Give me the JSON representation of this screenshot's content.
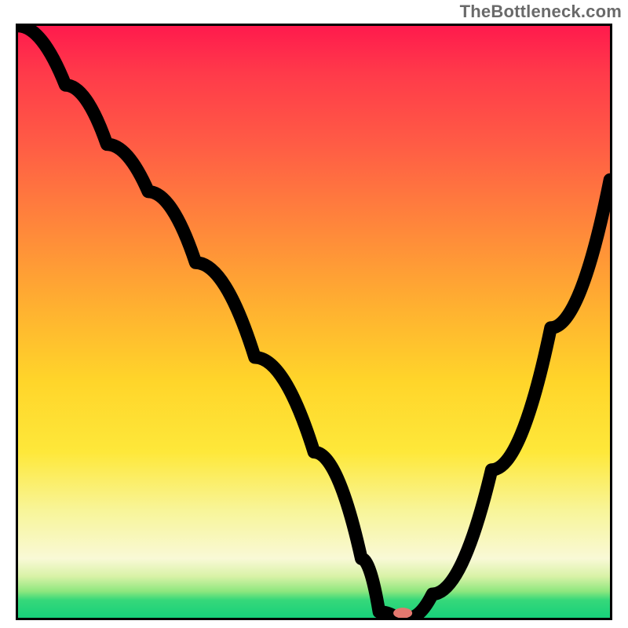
{
  "watermark": "TheBottleneck.com",
  "chart_data": {
    "type": "line",
    "title": "",
    "xlabel": "",
    "ylabel": "",
    "xlim": [
      0,
      100
    ],
    "ylim": [
      0,
      100
    ],
    "series": [
      {
        "name": "curve",
        "x": [
          0,
          8,
          15,
          22,
          30,
          40,
          50,
          58,
          61,
          64,
          66,
          70,
          80,
          90,
          100
        ],
        "y": [
          100,
          90,
          80,
          72,
          60,
          44,
          28,
          10,
          1,
          0,
          0,
          4,
          25,
          49,
          74
        ]
      }
    ],
    "marker": {
      "x": 65,
      "y": 0,
      "rx": 1.6,
      "ry": 0.9,
      "color": "#e4786f"
    },
    "gradient_stops": [
      {
        "pct": 0,
        "color": "#ff1a4d"
      },
      {
        "pct": 8,
        "color": "#ff3a4a"
      },
      {
        "pct": 20,
        "color": "#ff5c45"
      },
      {
        "pct": 35,
        "color": "#ff8a3a"
      },
      {
        "pct": 48,
        "color": "#ffb230"
      },
      {
        "pct": 60,
        "color": "#ffd52a"
      },
      {
        "pct": 72,
        "color": "#fee83a"
      },
      {
        "pct": 82,
        "color": "#f8f59a"
      },
      {
        "pct": 90,
        "color": "#f9f9d6"
      },
      {
        "pct": 93,
        "color": "#d9f2a7"
      },
      {
        "pct": 95.5,
        "color": "#8fe77f"
      },
      {
        "pct": 97,
        "color": "#36d87a"
      },
      {
        "pct": 100,
        "color": "#17d07a"
      }
    ]
  }
}
